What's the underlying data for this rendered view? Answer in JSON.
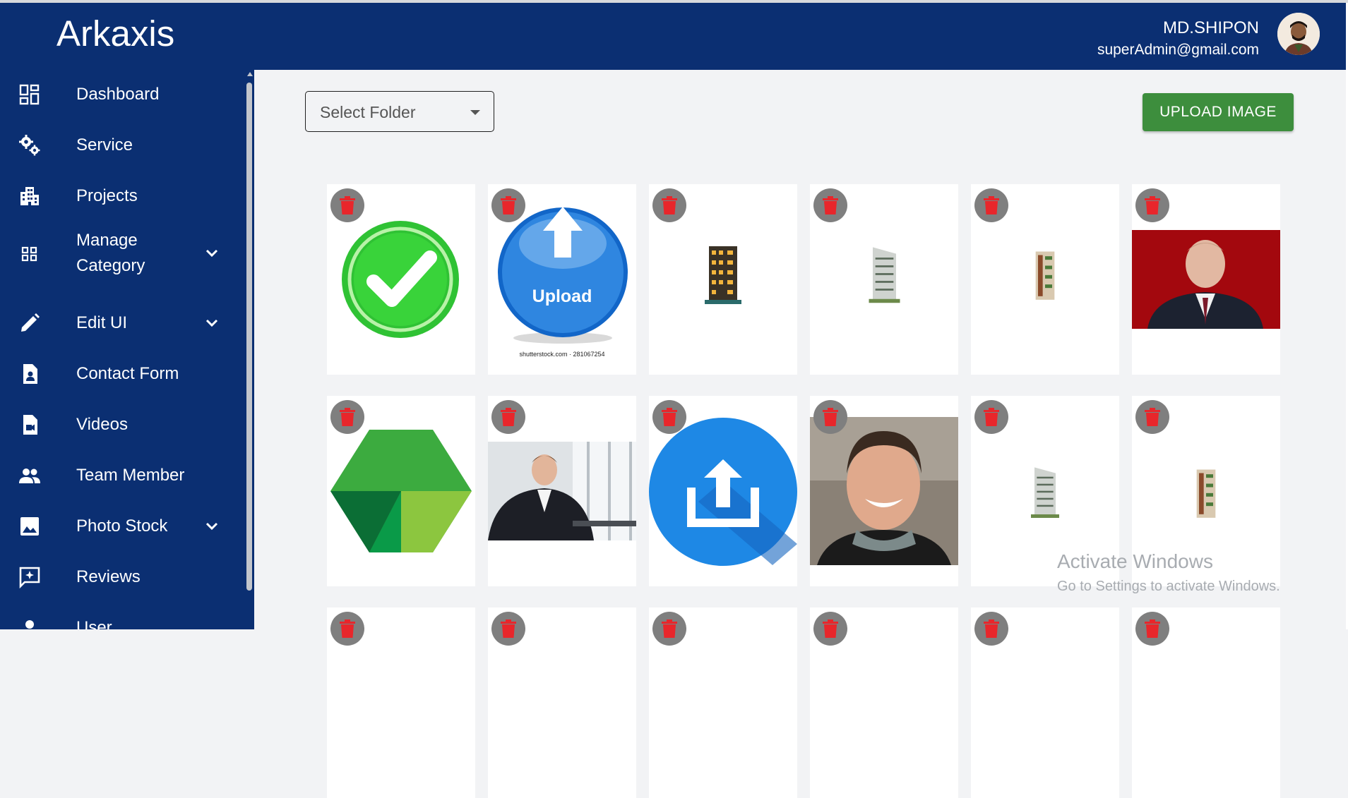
{
  "app": {
    "title": "Arkaxis"
  },
  "user": {
    "name": "MD.SHIPON",
    "email": "superAdmin@gmail.com"
  },
  "sidebar": {
    "items": [
      {
        "label": "Dashboard",
        "icon": "dashboard-icon"
      },
      {
        "label": "Service",
        "icon": "gears-icon"
      },
      {
        "label": "Projects",
        "icon": "building-icon"
      },
      {
        "label": "Manage Category",
        "icon": "category-icon",
        "expandable": true
      },
      {
        "label": "Edit UI",
        "icon": "pencil-icon",
        "expandable": true
      },
      {
        "label": "Contact Form",
        "icon": "contact-file-icon"
      },
      {
        "label": "Videos",
        "icon": "video-file-icon"
      },
      {
        "label": "Team Member",
        "icon": "people-icon"
      },
      {
        "label": "Photo Stock",
        "icon": "image-icon",
        "expandable": true
      },
      {
        "label": "Reviews",
        "icon": "review-icon"
      },
      {
        "label": "User",
        "icon": "user-icon"
      }
    ]
  },
  "toolbar": {
    "select_placeholder": "Select Folder",
    "upload_label": "UPLOAD IMAGE"
  },
  "gallery": {
    "images": [
      {
        "subject": "green check mark"
      },
      {
        "subject": "blue upload button",
        "caption": "Upload",
        "credit": "shutterstock.com · 281067254"
      },
      {
        "subject": "building night"
      },
      {
        "subject": "building white"
      },
      {
        "subject": "building facade"
      },
      {
        "subject": "man portrait red background"
      },
      {
        "subject": "green hexagon cube"
      },
      {
        "subject": "businessman office"
      },
      {
        "subject": "blue share upload icon"
      },
      {
        "subject": "man smiling portrait"
      },
      {
        "subject": "building tall"
      },
      {
        "subject": "building green"
      }
    ],
    "delete_icon": "trash-icon"
  },
  "os_watermark": {
    "line1": "Activate Windows",
    "line2": "Go to Settings to activate Windows."
  },
  "colors": {
    "header": "#0b2f72",
    "upload_button": "#3d8e3d",
    "delete_badge": "#7f7f7f",
    "trash": "#e8262b"
  }
}
